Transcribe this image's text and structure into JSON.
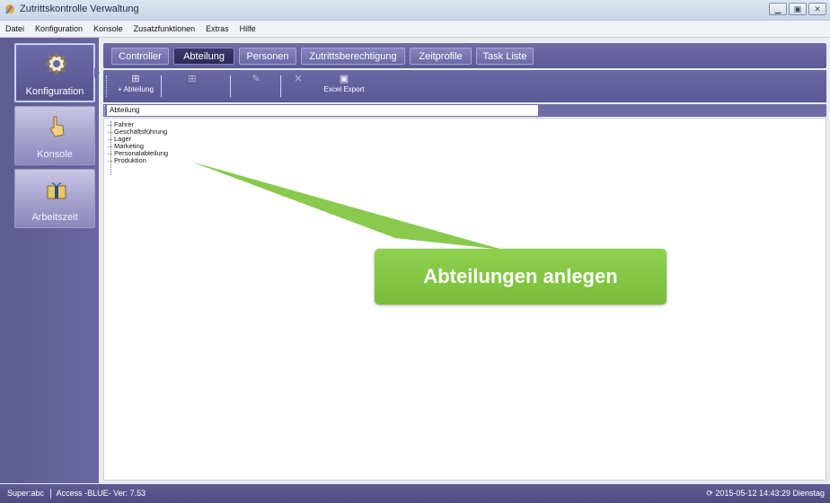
{
  "window": {
    "title": "Zutrittskontrolle Verwaltung",
    "minimize_icon": "minimize-icon",
    "maximize_icon": "maximize-icon",
    "close_icon": "close-icon"
  },
  "menubar": [
    "Datei",
    "Konfiguration",
    "Konsole",
    "Zusatzfunktionen",
    "Extras",
    "Hilfe"
  ],
  "sidebar": {
    "items": [
      {
        "label": "Konfiguration",
        "icon": "gear-icon",
        "active": true
      },
      {
        "label": "Konsole",
        "icon": "hand-pointer-icon",
        "active": false
      },
      {
        "label": "Arbeitszeit",
        "icon": "gift-box-icon",
        "active": false
      }
    ]
  },
  "tabs": [
    {
      "label": "Controller",
      "active": false
    },
    {
      "label": "Abteilung",
      "active": true
    },
    {
      "label": "Personen",
      "active": false
    },
    {
      "label": "Zutrittsberechtigung",
      "active": false
    },
    {
      "label": "Zeitprofile",
      "active": false
    },
    {
      "label": "Task Liste",
      "active": false
    }
  ],
  "toolbar": {
    "add_label": "+ Abteilung",
    "excel_label": "Excel Export"
  },
  "content": {
    "header_label": "Abteilung",
    "departments": [
      "Fahrer",
      "Geschäftsführung",
      "Lager",
      "Marketing",
      "Personalabteilung",
      "Produktion"
    ]
  },
  "callout": {
    "text": "Abteilungen anlegen",
    "color": "#82c645"
  },
  "status": {
    "user": "Super:abc",
    "version": "Access -BLUE- Ver: 7.53",
    "datetime": "2015-05-12 14:43:29 Dienstag"
  },
  "colors": {
    "accent": "#5c5996",
    "callout": "#82c645"
  }
}
